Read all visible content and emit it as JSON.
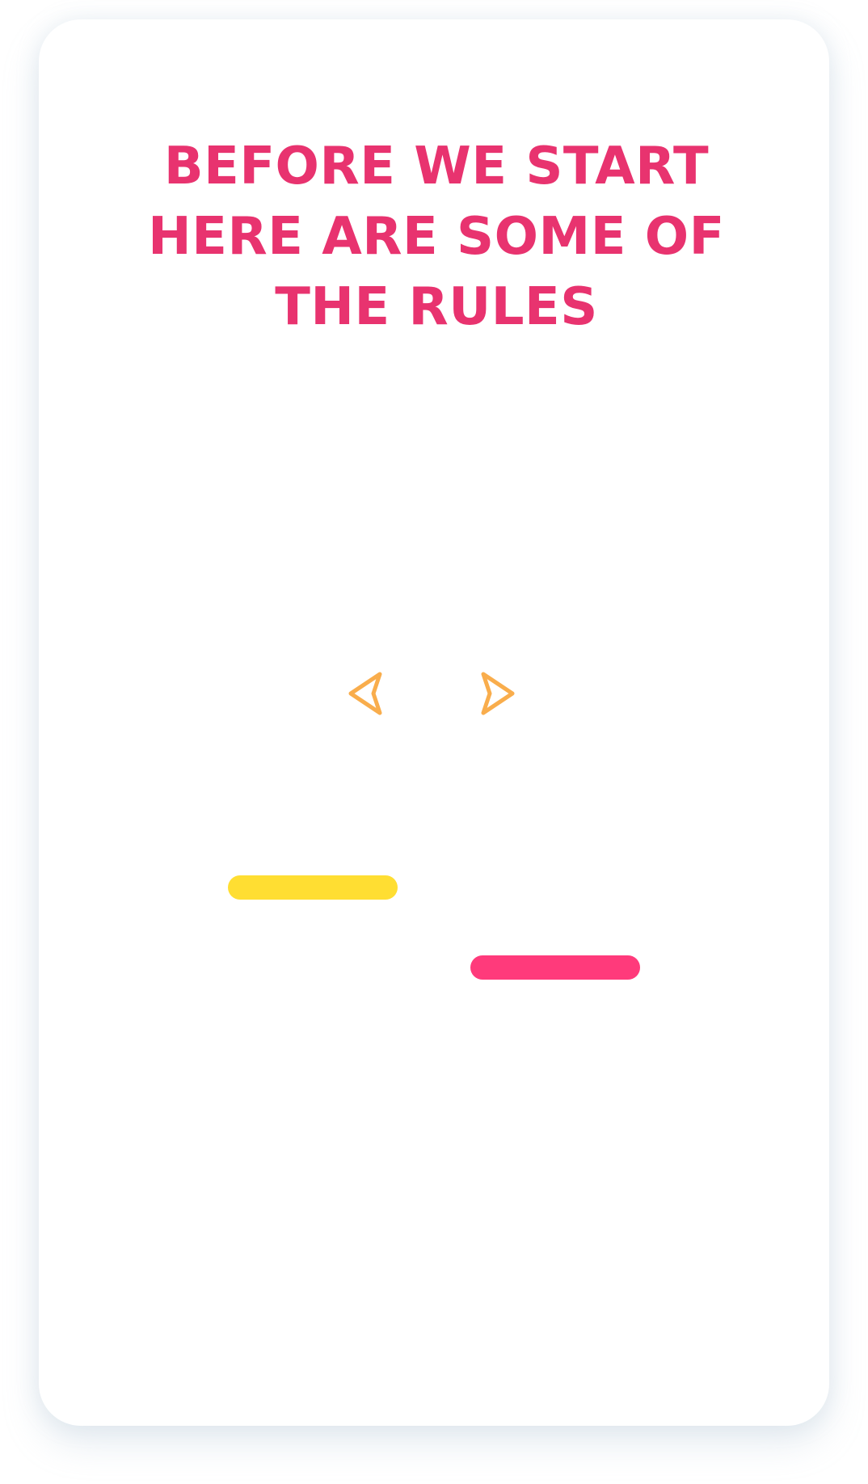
{
  "rules": {
    "title": "BEFORE WE START HERE ARE SOME OF THE RULES"
  },
  "navigation": {
    "prev_icon": "arrow-left-icon",
    "next_icon": "arrow-right-icon",
    "arrow_color": "#f9ad4c"
  },
  "decorations": {
    "bar_yellow_color": "#ffde32",
    "bar_pink_color": "#ff3a7b",
    "title_color": "#e8336f"
  }
}
